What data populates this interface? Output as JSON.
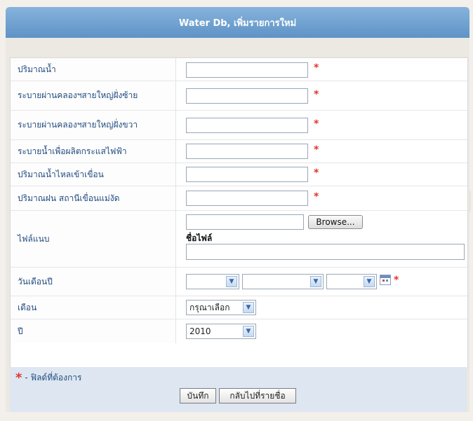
{
  "header": {
    "title": "Water Db, เพิ่มรายการใหม่"
  },
  "fields": {
    "water_volume": {
      "label": "ปริมาณน้ำ",
      "value": "",
      "required": true
    },
    "drain_left": {
      "label": "ระบายผ่านคลองฯสายใหญ่ฝั่งซ้าย",
      "value": "",
      "required": true
    },
    "drain_right": {
      "label": "ระบายผ่านคลองฯสายใหญ่ฝั่งขวา",
      "value": "",
      "required": true
    },
    "drain_power": {
      "label": "ระบายน้ำเพื่อผลิตกระแสไฟฟ้า",
      "value": "",
      "required": true
    },
    "inflow": {
      "label": "ปริมาณน้ำไหลเข้าเขื่อน",
      "value": "",
      "required": true
    },
    "rainfall": {
      "label": "ปริมาณฝน สถานีเขื่อนแม่งัด",
      "value": "",
      "required": true
    },
    "attachment": {
      "label": "ไฟล์แนบ",
      "browse_label": "Browse...",
      "filename_label": "ชื่อไฟล์",
      "filename_value": ""
    },
    "date": {
      "label": "วันเดือนปี",
      "day": "",
      "month": "",
      "year": "",
      "required": true
    },
    "month": {
      "label": "เดือน",
      "selected": "กรุณาเลือก"
    },
    "year": {
      "label": "ปี",
      "selected": "2010"
    }
  },
  "footer": {
    "required_note": "- ฟิลด์ที่ต้องการ",
    "save_label": "บันทึก",
    "back_label": "กลับไปที่รายชื่อ"
  },
  "colors": {
    "header": "#6b9fd0",
    "required": "#e0352b",
    "footer": "#dde6f1"
  }
}
